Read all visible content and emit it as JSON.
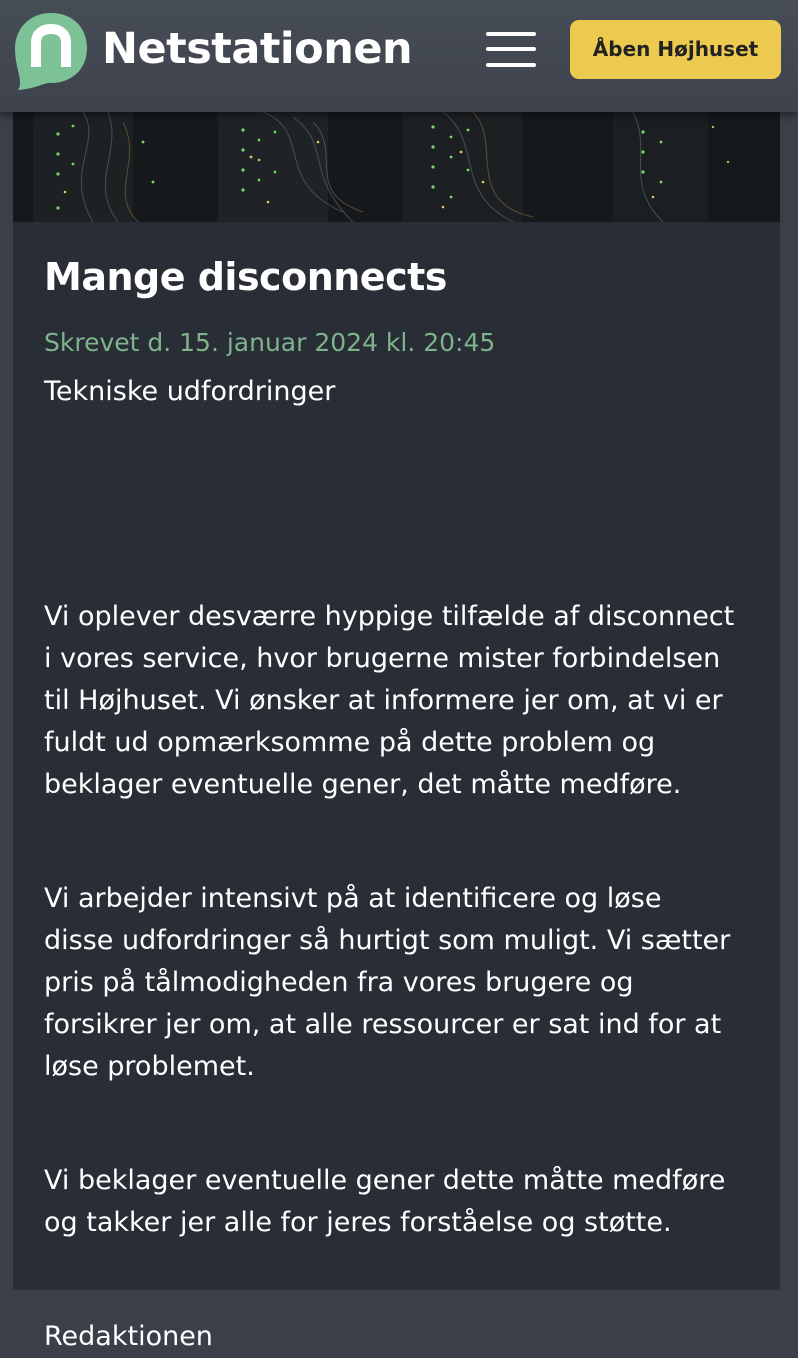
{
  "header": {
    "brand": "Netstationen",
    "cta_label": "Åben Højhuset",
    "menu_icon": "hamburger-menu-icon",
    "logo_icon": "speech-bubble-logo-icon"
  },
  "hero": {
    "image": "server-rack-lights-image"
  },
  "article": {
    "title": "Mange disconnects",
    "meta": "Skrevet d. 15. januar 2024 kl. 20:45",
    "category": "Tekniske udfordringer",
    "paragraphs": [
      {
        "lines": [
          "Vi oplever desværre hyppige tilfælde af disconnect",
          "i vores service, hvor brugerne mister forbindelsen",
          "til Højhuset. Vi ønsker at informere jer om, at vi er",
          "fuldt ud opmærksomme på dette problem og",
          "beklager eventuelle gener, det måtte medføre."
        ]
      },
      {
        "lines": [
          "Vi arbejder intensivt på at identificere og løse",
          "disse udfordringer så hurtigt som muligt. Vi sætter",
          "pris på tålmodigheden fra vores brugere og",
          "forsikrer jer om, at alle ressourcer er sat ind for at",
          "løse problemet."
        ]
      },
      {
        "lines": [
          "Vi beklager eventuelle gener dette måtte medføre",
          "og takker jer alle for jeres forståelse og støtte."
        ]
      }
    ],
    "signoff": "Redaktionen"
  },
  "colors": {
    "page_bg": "#3a3f49",
    "header_bg": "#434852",
    "card_bg": "#282d36",
    "accent_yellow": "#ecca4f",
    "logo_green": "#7cc296",
    "meta_green": "#7fb38c",
    "text": "#ffffff"
  }
}
